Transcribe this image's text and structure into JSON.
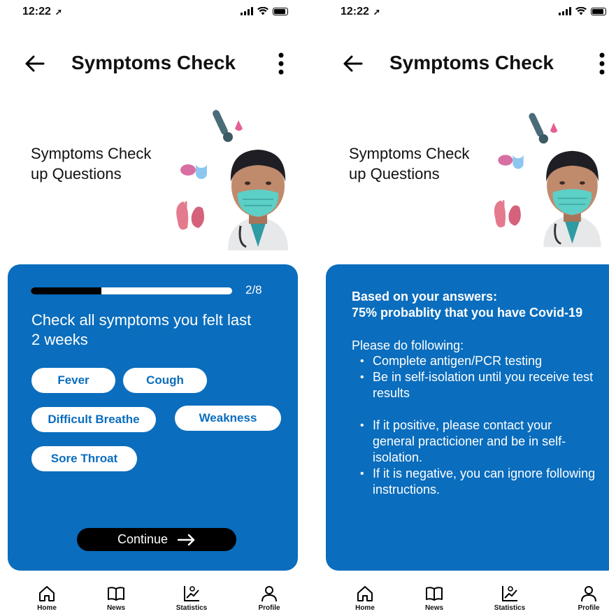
{
  "status_bar": {
    "time": "12:22"
  },
  "screens": [
    {
      "title": "Symptoms Check",
      "hero_title": "Symptoms Check up Questions",
      "progress": {
        "fraction": 0.35,
        "label": "2/8"
      },
      "question": "Check all symptoms you felt last 2 weeks",
      "chips": [
        "Fever",
        "Cough",
        "Difficult Breathe",
        "Weakness",
        "Sore Throat"
      ],
      "continue_label": "Continue"
    },
    {
      "title": "Symptoms Check",
      "hero_title": "Symptoms Check up Questions",
      "result_heading_1": "Based on your answers:",
      "result_heading_2": "75% probablity that you have Covid-19",
      "instructions_title": "Please do following:",
      "steps": [
        "Complete antigen/PCR testing",
        "Be in self-isolation until you receive test results",
        "If it positive, please contact your general practicioner and be in self-isolation.",
        "If it is negative, you can ignore following instructions."
      ]
    }
  ],
  "tabbar": {
    "items": [
      {
        "label": "Home",
        "icon": "home-icon"
      },
      {
        "label": "News",
        "icon": "book-icon"
      },
      {
        "label": "Statistics",
        "icon": "statistics-icon"
      },
      {
        "label": "Profile",
        "icon": "profile-icon"
      }
    ]
  },
  "colors": {
    "accent": "#0a6dbd",
    "card_text": "#ffffff",
    "button": "#000000"
  }
}
